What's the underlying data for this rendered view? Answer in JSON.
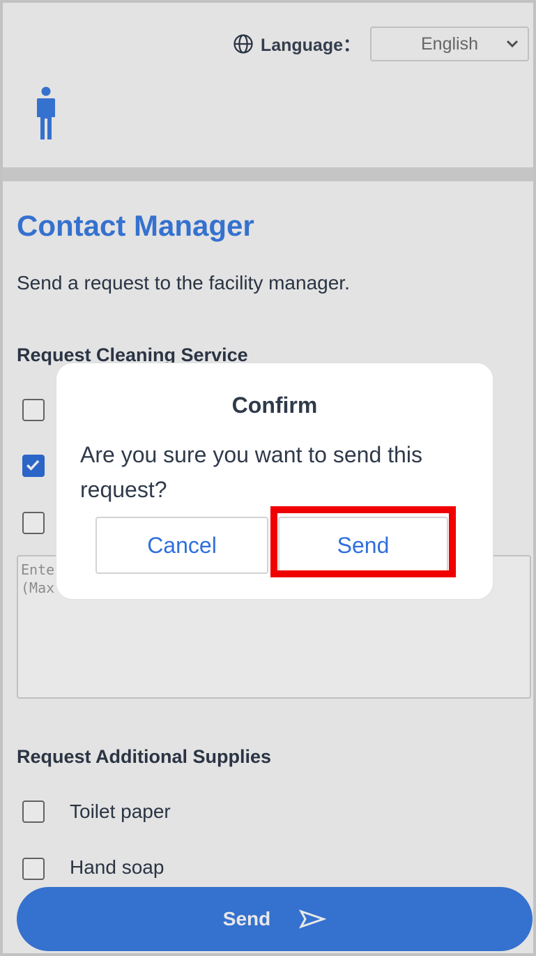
{
  "header": {
    "language_label": "Language：",
    "language_value": "English"
  },
  "page": {
    "title": "Contact Manager",
    "subtitle": "Send a request to the facility manager."
  },
  "cleaning": {
    "section_title": "Request Cleaning Service",
    "items": [
      {
        "checked": false
      },
      {
        "checked": true
      },
      {
        "checked": false
      }
    ],
    "textarea_placeholder": "Ente\n(Max"
  },
  "supplies": {
    "section_title": "Request Additional Supplies",
    "items": [
      {
        "label": "Toilet paper",
        "checked": false
      },
      {
        "label": "Hand soap",
        "checked": false
      }
    ]
  },
  "send_button": {
    "label": "Send"
  },
  "dialog": {
    "title": "Confirm",
    "message": "Are you sure you want to send this request?",
    "cancel_label": "Cancel",
    "send_label": "Send"
  },
  "colors": {
    "accent": "#3b7de3",
    "highlight": "#f00000"
  }
}
